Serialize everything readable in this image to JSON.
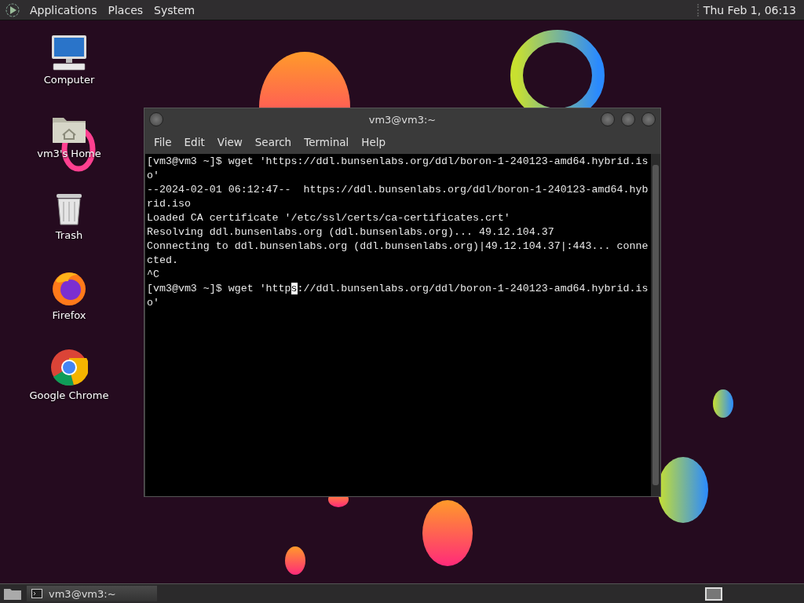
{
  "top_panel": {
    "menus": [
      "Applications",
      "Places",
      "System"
    ],
    "clock": "Thu Feb  1, 06:13"
  },
  "desktop_icons": [
    {
      "kind": "computer",
      "label": "Computer"
    },
    {
      "kind": "home",
      "label": "vm3's Home"
    },
    {
      "kind": "trash",
      "label": "Trash"
    },
    {
      "kind": "firefox",
      "label": "Firefox"
    },
    {
      "kind": "chrome",
      "label": "Google Chrome"
    }
  ],
  "terminal": {
    "title": "vm3@vm3:~",
    "menu": [
      "File",
      "Edit",
      "View",
      "Search",
      "Terminal",
      "Help"
    ],
    "lines": [
      "[vm3@vm3 ~]$ wget 'https://ddl.bunsenlabs.org/ddl/boron-1-240123-amd64.hybrid.is",
      "o'",
      "--2024-02-01 06:12:47--  https://ddl.bunsenlabs.org/ddl/boron-1-240123-amd64.hyb",
      "rid.iso",
      "Loaded CA certificate '/etc/ssl/certs/ca-certificates.crt'",
      "Resolving ddl.bunsenlabs.org (ddl.bunsenlabs.org)... 49.12.104.37",
      "Connecting to ddl.bunsenlabs.org (ddl.bunsenlabs.org)|49.12.104.37|:443... conne",
      "cted.",
      "^C"
    ],
    "cursor_line": {
      "before": "[vm3@vm3 ~]$ wget 'http",
      "cursor": "s",
      "after": "://ddl.bunsenlabs.org/ddl/boron-1-240123-amd64.hybrid.is"
    },
    "after_lines": [
      "o'"
    ]
  },
  "taskbar": {
    "tasks": [
      {
        "label": "vm3@vm3:~",
        "selected": true
      }
    ]
  }
}
